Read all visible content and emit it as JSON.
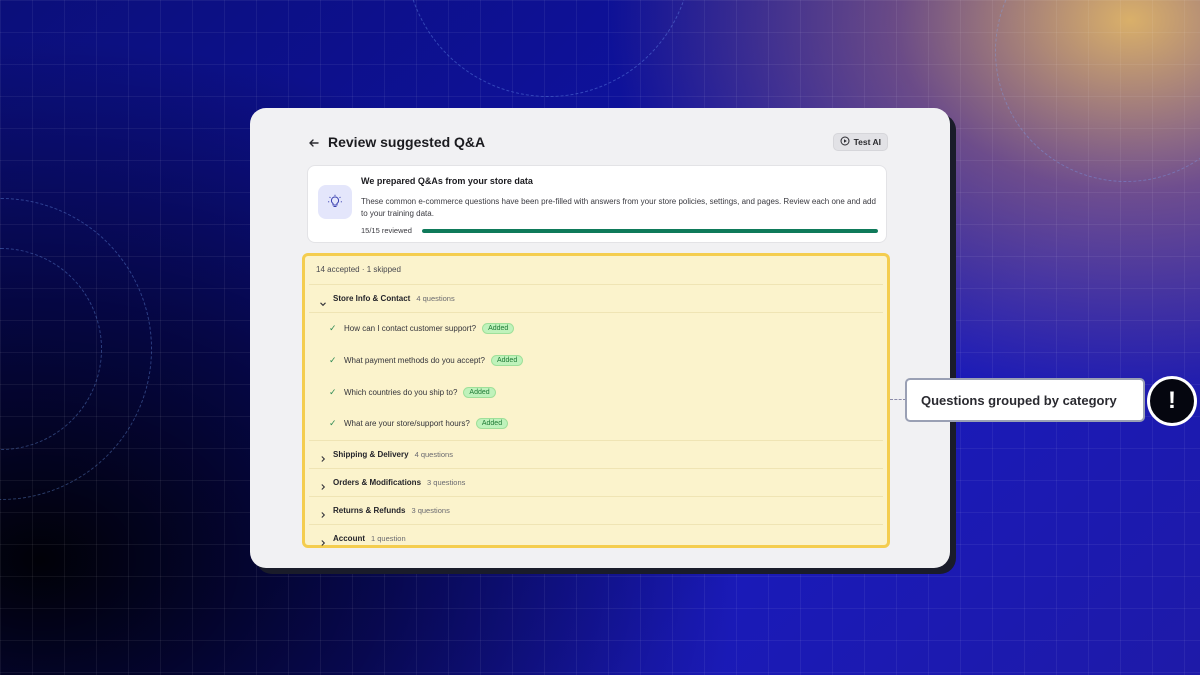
{
  "header": {
    "title": "Review suggested Q&A",
    "test_ai_label": "Test AI"
  },
  "info": {
    "title": "We prepared Q&As from your store data",
    "description": "These common e-commerce questions have been pre-filled with answers from your store policies, settings, and pages. Review each one and add to your training data.",
    "progress_label": "15/15 reviewed",
    "progress_fraction": 1.0
  },
  "summary": "14 accepted · 1 skipped",
  "categories": [
    {
      "name": "Store Info & Contact",
      "count": "4 questions",
      "expanded": true,
      "questions": [
        {
          "text": "How can I contact customer support?",
          "badge": "Added"
        },
        {
          "text": "What payment methods do you accept?",
          "badge": "Added"
        },
        {
          "text": "Which countries do you ship to?",
          "badge": "Added"
        },
        {
          "text": "What are your store/support hours?",
          "badge": "Added"
        }
      ]
    },
    {
      "name": "Shipping & Delivery",
      "count": "4 questions",
      "expanded": false
    },
    {
      "name": "Orders & Modifications",
      "count": "3 questions",
      "expanded": false
    },
    {
      "name": "Returns & Refunds",
      "count": "3 questions",
      "expanded": false
    },
    {
      "name": "Account",
      "count": "1 question",
      "expanded": false
    }
  ],
  "callout": {
    "text": "Questions grouped by category",
    "icon_symbol": "!"
  },
  "colors": {
    "highlight_border": "#f4cd4f",
    "progress": "#0f7a5a",
    "badge_bg": "#bff2bb"
  }
}
